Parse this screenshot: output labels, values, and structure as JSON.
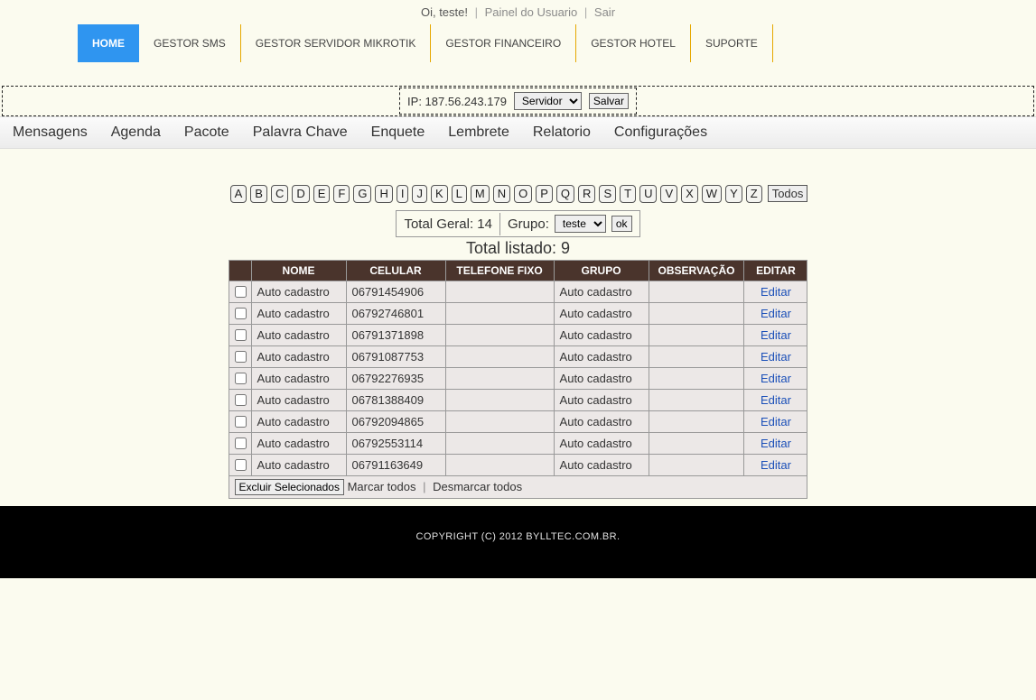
{
  "topbar": {
    "greeting": "Oi, teste!",
    "panel_link": "Painel do Usuario",
    "logout": "Sair"
  },
  "main_nav": [
    "HOME",
    "GESTOR SMS",
    "GESTOR SERVIDOR MIKROTIK",
    "GESTOR FINANCEIRO",
    "GESTOR HOTEL",
    "SUPORTE"
  ],
  "ip_bar": {
    "label": "IP: 187.56.243.179",
    "select_value": "Servidor",
    "save": "Salvar"
  },
  "subnav": [
    "Mensagens",
    "Agenda",
    "Pacote",
    "Palavra Chave",
    "Enquete",
    "Lembrete",
    "Relatorio",
    "Configurações"
  ],
  "alpha": [
    "A",
    "B",
    "C",
    "D",
    "E",
    "F",
    "G",
    "H",
    "I",
    "J",
    "K",
    "L",
    "M",
    "N",
    "O",
    "P",
    "Q",
    "R",
    "S",
    "T",
    "U",
    "V",
    "X",
    "W",
    "Y",
    "Z"
  ],
  "alpha_all": "Todos",
  "summary": {
    "total_geral": "Total Geral: 14",
    "grupo_label": "Grupo:",
    "grupo_value": "teste",
    "ok": "ok"
  },
  "total_listed": "Total listado: 9",
  "headers": {
    "nome": "NOME",
    "celular": "CELULAR",
    "telefone": "TELEFONE FIXO",
    "grupo": "GRUPO",
    "observacao": "OBSERVAÇÃO",
    "editar": "EDITAR"
  },
  "rows": [
    {
      "nome": "Auto cadastro",
      "celular": "06791454906",
      "telefone": "",
      "grupo": "Auto cadastro",
      "obs": "",
      "editar": "Editar"
    },
    {
      "nome": "Auto cadastro",
      "celular": "06792746801",
      "telefone": "",
      "grupo": "Auto cadastro",
      "obs": "",
      "editar": "Editar"
    },
    {
      "nome": "Auto cadastro",
      "celular": "06791371898",
      "telefone": "",
      "grupo": "Auto cadastro",
      "obs": "",
      "editar": "Editar"
    },
    {
      "nome": "Auto cadastro",
      "celular": "06791087753",
      "telefone": "",
      "grupo": "Auto cadastro",
      "obs": "",
      "editar": "Editar"
    },
    {
      "nome": "Auto cadastro",
      "celular": "06792276935",
      "telefone": "",
      "grupo": "Auto cadastro",
      "obs": "",
      "editar": "Editar"
    },
    {
      "nome": "Auto cadastro",
      "celular": "06781388409",
      "telefone": "",
      "grupo": "Auto cadastro",
      "obs": "",
      "editar": "Editar"
    },
    {
      "nome": "Auto cadastro",
      "celular": "06792094865",
      "telefone": "",
      "grupo": "Auto cadastro",
      "obs": "",
      "editar": "Editar"
    },
    {
      "nome": "Auto cadastro",
      "celular": "06792553114",
      "telefone": "",
      "grupo": "Auto cadastro",
      "obs": "",
      "editar": "Editar"
    },
    {
      "nome": "Auto cadastro",
      "celular": "06791163649",
      "telefone": "",
      "grupo": "Auto cadastro",
      "obs": "",
      "editar": "Editar"
    }
  ],
  "actions": {
    "delete": "Excluir Selecionados",
    "mark_all": "Marcar todos",
    "unmark_all": "Desmarcar todos"
  },
  "footer": "COPYRIGHT (C) 2012 BYLLTEC.COM.BR."
}
